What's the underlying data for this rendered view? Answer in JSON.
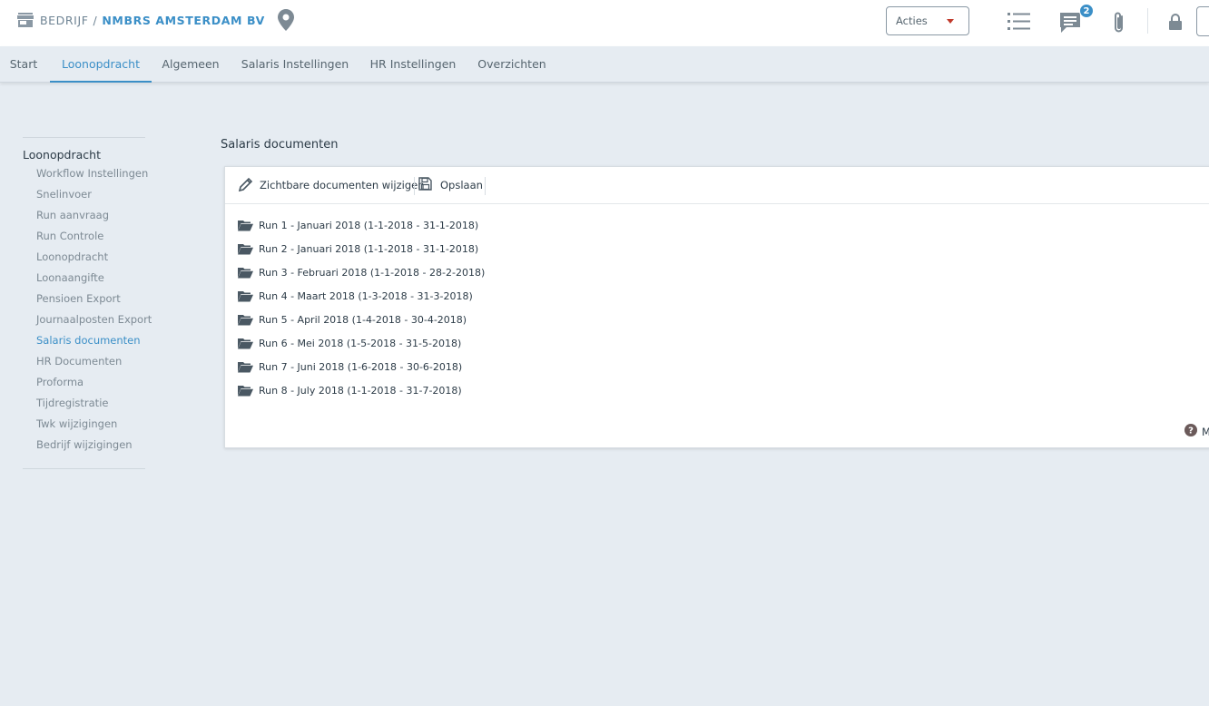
{
  "header": {
    "crumb_company": "BEDRIJF",
    "crumb_separator": "/",
    "crumb_name": "NMBRS AMSTERDAM BV",
    "actions_label": "Acties",
    "messages_badge": "2"
  },
  "tabs": [
    {
      "label": "Start"
    },
    {
      "label": "Loonopdracht"
    },
    {
      "label": "Algemeen"
    },
    {
      "label": "Salaris Instellingen"
    },
    {
      "label": "HR Instellingen"
    },
    {
      "label": "Overzichten"
    }
  ],
  "sidebar": {
    "heading": "Loonopdracht",
    "items": [
      {
        "label": "Workflow Instellingen"
      },
      {
        "label": "Snelinvoer"
      },
      {
        "label": "Run aanvraag"
      },
      {
        "label": "Run Controle"
      },
      {
        "label": "Loonopdracht"
      },
      {
        "label": "Loonaangifte"
      },
      {
        "label": "Pensioen Export"
      },
      {
        "label": "Journaalposten Export"
      },
      {
        "label": "Salaris documenten"
      },
      {
        "label": "HR Documenten"
      },
      {
        "label": "Proforma"
      },
      {
        "label": "Tijdregistratie"
      },
      {
        "label": "Twk wijzigingen"
      },
      {
        "label": "Bedrijf wijzigingen"
      }
    ],
    "active_index": 8
  },
  "main": {
    "title": "Salaris documenten",
    "toolbar": {
      "edit_label": "Zichtbare documenten wijzigen",
      "save_label": "Opslaan"
    },
    "runs": [
      {
        "label": "Run 1 - Januari 2018 (1-1-2018 - 31-1-2018)"
      },
      {
        "label": "Run 2 - Januari 2018 (1-1-2018 - 31-1-2018)"
      },
      {
        "label": "Run 3 - Februari 2018 (1-1-2018 - 28-2-2018)"
      },
      {
        "label": "Run 4 - Maart 2018 (1-3-2018 - 31-3-2018)"
      },
      {
        "label": "Run 5 - April 2018 (1-4-2018 - 30-4-2018)"
      },
      {
        "label": "Run 6 - Mei 2018 (1-5-2018 - 31-5-2018)"
      },
      {
        "label": "Run 7 - Juni 2018 (1-6-2018 - 30-6-2018)"
      },
      {
        "label": "Run 8 - July 2018 (1-1-2018 - 31-7-2018)"
      }
    ],
    "help_label": "M"
  },
  "colors": {
    "accent": "#3b8fc7",
    "background": "#e6ecf2",
    "muted_text": "#7d8a94"
  },
  "icons": [
    "store-icon",
    "location-pin-icon",
    "list-icon",
    "messages-icon",
    "paperclip-icon",
    "lock-icon",
    "pencil-icon",
    "save-icon",
    "folder-open-icon",
    "help-icon"
  ]
}
